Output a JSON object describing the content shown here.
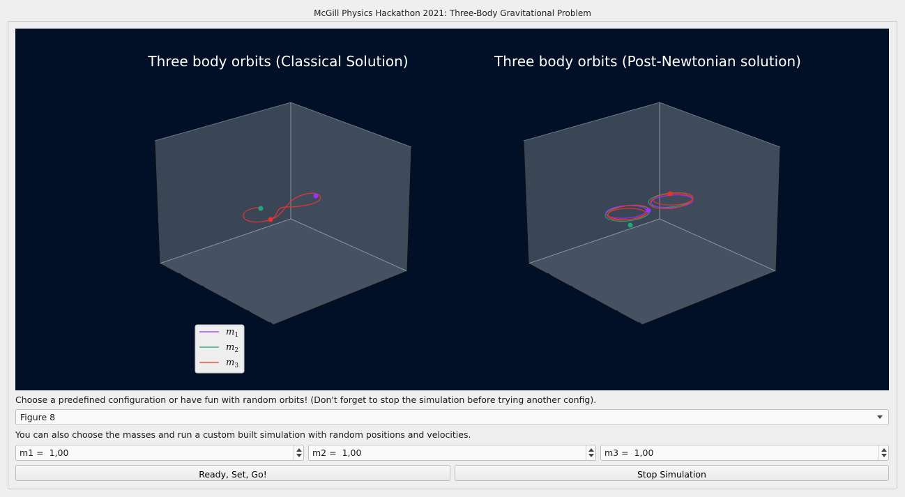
{
  "window": {
    "title": "McGill Physics Hackathon 2021: Three-Body Gravitational Problem"
  },
  "plots": {
    "left_title": "Three body orbits (Classical Solution)",
    "right_title": "Three body orbits (Post-Newtonian solution)",
    "legend": [
      {
        "label": "m",
        "sub": "1",
        "color": "#9b30ff"
      },
      {
        "label": "m",
        "sub": "2",
        "color": "#1fa67a"
      },
      {
        "label": "m",
        "sub": "3",
        "color": "#e8352b"
      }
    ]
  },
  "controls": {
    "config_prompt": "Choose a predefined configuration or have fun with random orbits! (Don't forget to stop the simulation before trying another config).",
    "config_selected": "Figure 8",
    "mass_prompt": "You can also choose the masses and run a custom built simulation with random positions and velocities.",
    "m1": {
      "prefix": "m1 =",
      "value": "1,00"
    },
    "m2": {
      "prefix": "m2 =",
      "value": "1,00"
    },
    "m3": {
      "prefix": "m3 =",
      "value": "1,00"
    },
    "go_button": "Ready, Set, Go!",
    "stop_button": "Stop Simulation"
  }
}
